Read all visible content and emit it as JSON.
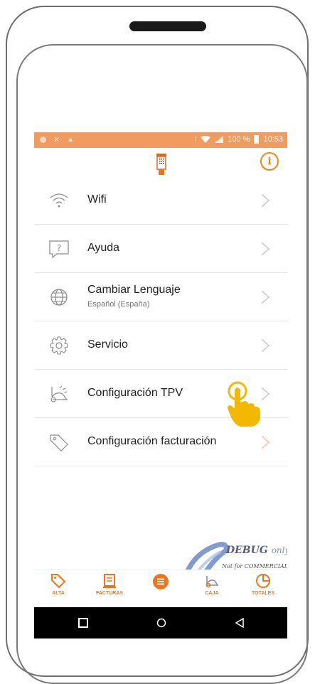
{
  "status_bar": {
    "battery_percent": "100 %",
    "time": "10:53"
  },
  "menu": {
    "items": [
      {
        "label": "Wifi",
        "icon": "wifi-icon"
      },
      {
        "label": "Ayuda",
        "icon": "help-icon"
      },
      {
        "label": "Cambiar Lenguaje",
        "sublabel": "Español (España)",
        "icon": "globe-icon"
      },
      {
        "label": "Servicio",
        "icon": "gear-icon"
      },
      {
        "label": "Configuración TPV",
        "icon": "pos-terminal-icon"
      },
      {
        "label": "Configuración facturación",
        "icon": "tag-icon"
      }
    ]
  },
  "bottom_nav": {
    "items": [
      {
        "label": "ALTA",
        "icon": "tag-icon"
      },
      {
        "label": "FACTURAS",
        "icon": "invoice-icon"
      },
      {
        "label": "",
        "icon": "menu-icon"
      },
      {
        "label": "CAJA",
        "icon": "cash-register-icon"
      },
      {
        "label": "TOTALES",
        "icon": "pie-chart-icon"
      }
    ]
  },
  "watermark": {
    "title": "DEBUG",
    "suffix": "only",
    "note": "Not for COMMERCIAL"
  },
  "colors": {
    "accent": "#e8781f",
    "status_bar": "#f19b5e",
    "touch_hand": "#f5b800"
  }
}
